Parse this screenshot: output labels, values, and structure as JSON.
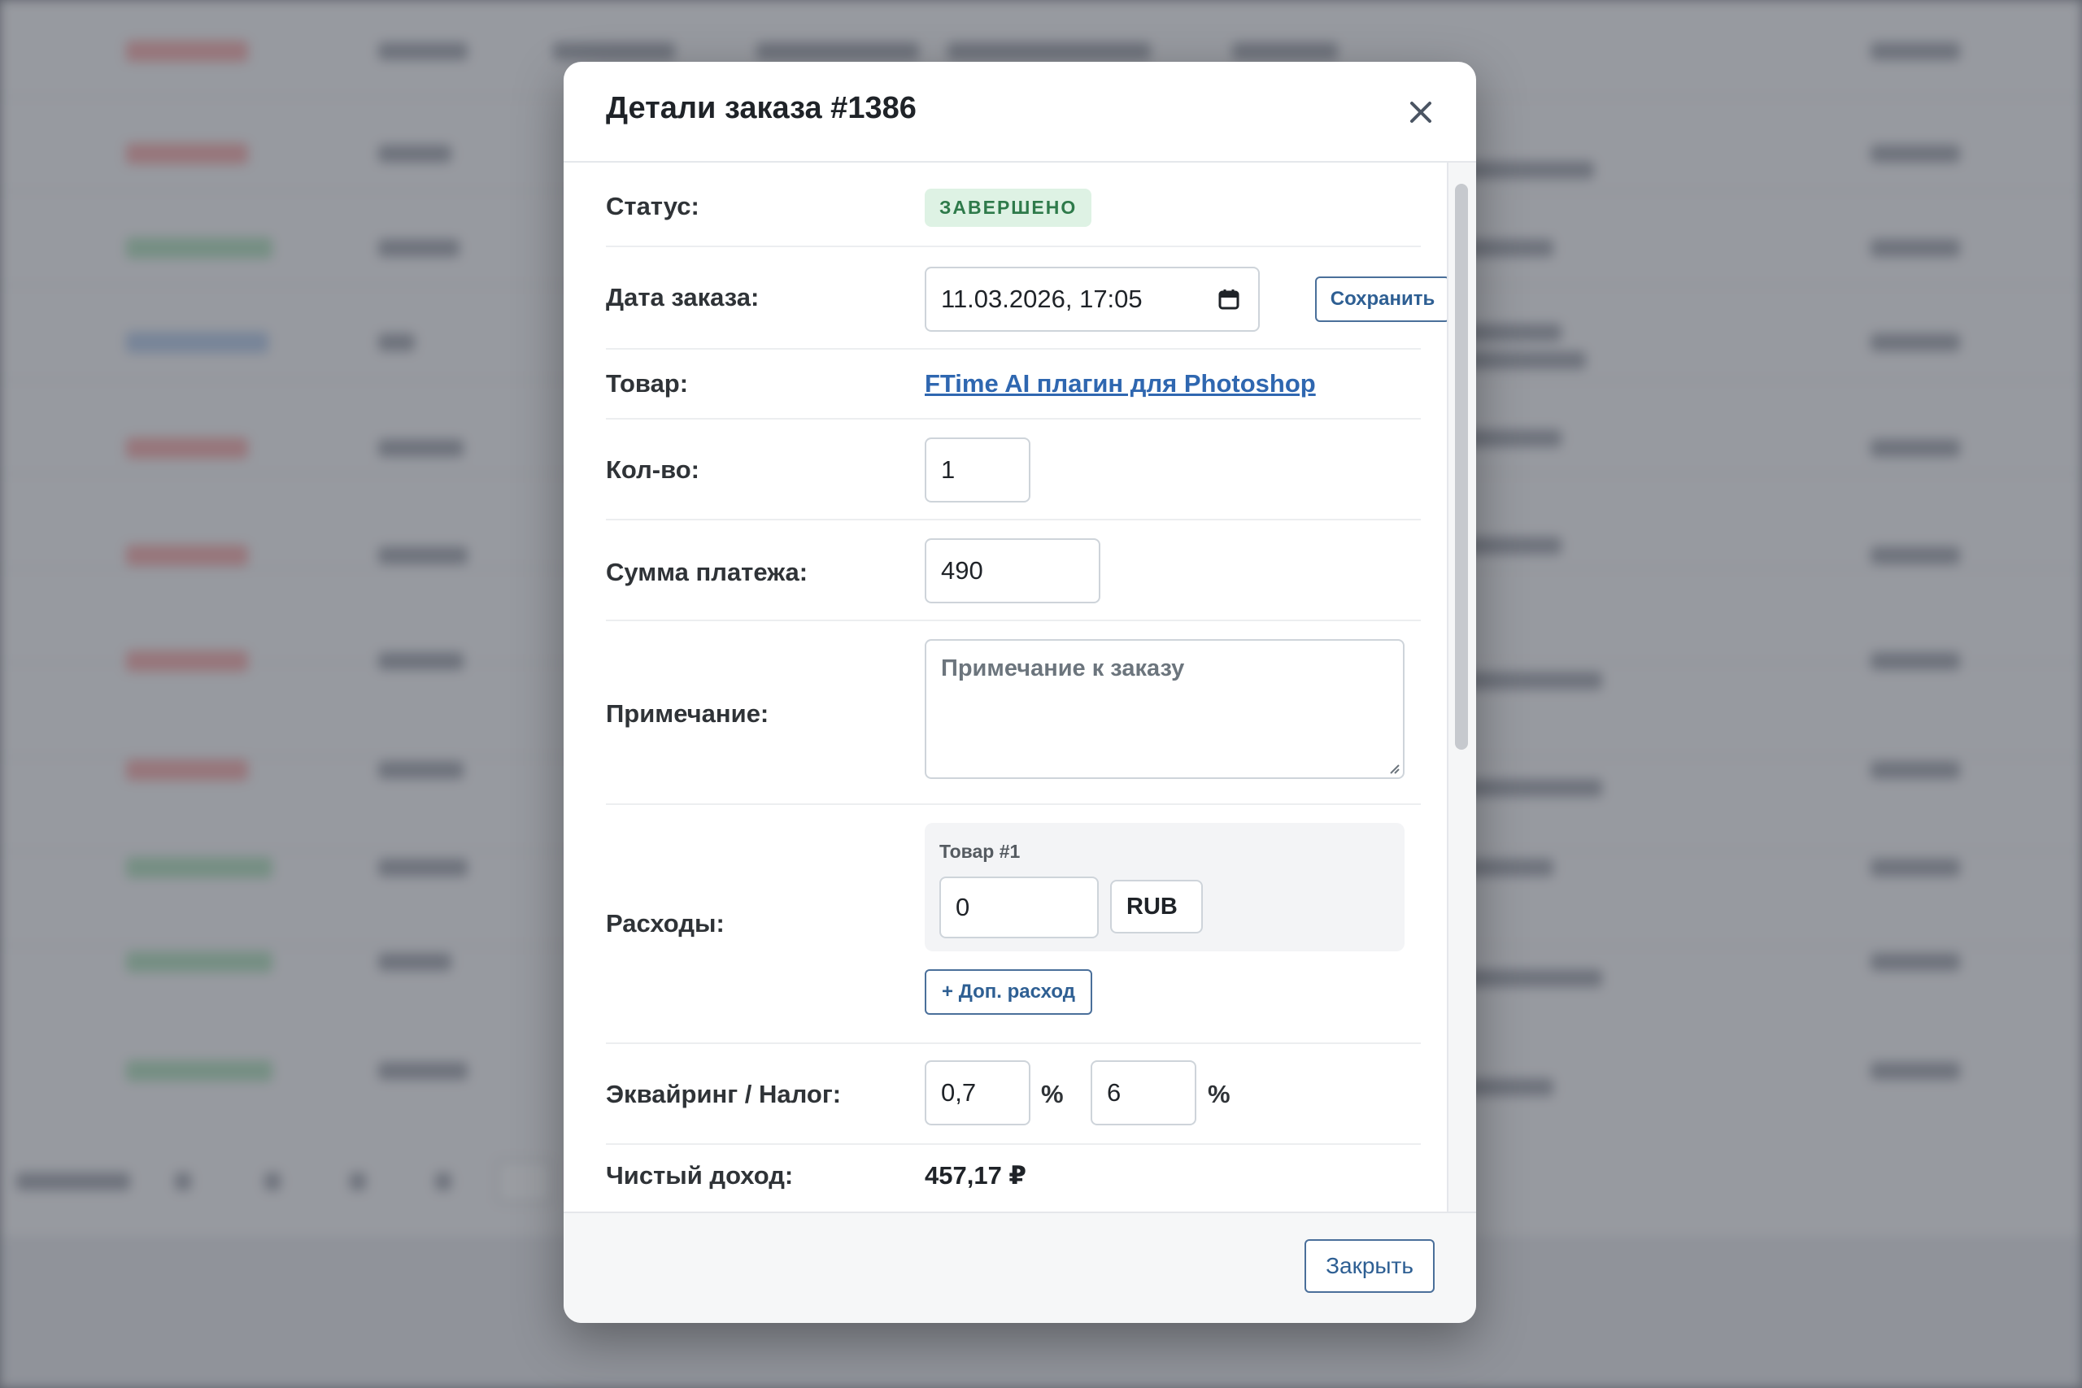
{
  "modal": {
    "title": "Детали заказа #1386",
    "close_icon": "close-icon",
    "fields": {
      "status_label": "Статус:",
      "status_value": "ЗАВЕРШЕНО",
      "status_color": "#2e7a4a",
      "date_label": "Дата заказа:",
      "date_value": "11.03.2026, 17:05",
      "date_icon": "calendar-icon",
      "save_label": "Сохранить",
      "product_label": "Товар:",
      "product_value": "FTime AI плагин для Photoshop",
      "qty_label": "Кол-во:",
      "qty_value": "1",
      "amount_label": "Сумма платежа:",
      "amount_value": "490",
      "note_label": "Примечание:",
      "note_placeholder": "Примечание к заказу",
      "expenses_label": "Расходы:",
      "expense_item_title": "Товар #1",
      "expense_item_value": "0",
      "expense_item_currency": "RUB",
      "add_expense_label": "+ Доп. расход",
      "acquiring_label": "Эквайринг / Налог:",
      "acquiring_value": "0,7",
      "tax_value": "6",
      "percent_sign": "%",
      "net_income_label": "Чистый доход:",
      "net_income_value": "457,17 ₽"
    },
    "footer": {
      "close_label": "Закрыть"
    }
  },
  "colors": {
    "accent": "#2f67b0",
    "success_bg": "#def2e4",
    "success_text": "#2e7a4a"
  }
}
